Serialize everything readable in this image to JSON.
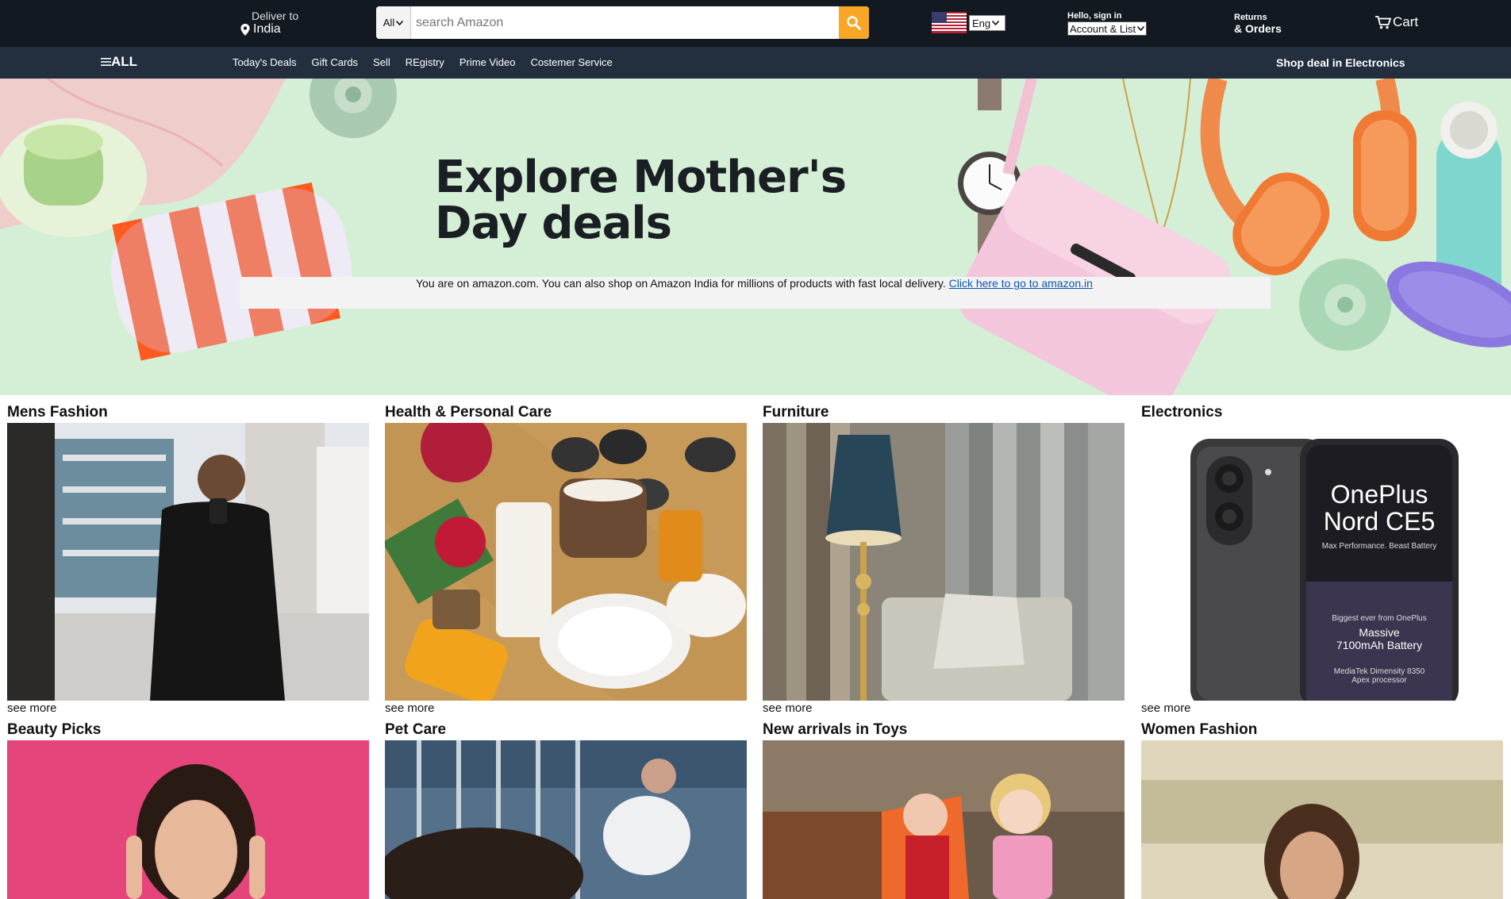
{
  "header": {
    "deliver_to": "Deliver to",
    "location": "India",
    "search_category": "All",
    "search_placeholder": "search Amazon",
    "language": "Eng",
    "greeting": "Hello, sign in",
    "account_select": "Account & List",
    "returns": "Returns",
    "orders": "& Orders",
    "cart": "Cart"
  },
  "nav": {
    "all": "ALL",
    "links": [
      "Today's Deals",
      "Gift Cards",
      "Sell",
      "REgistry",
      "Prime Video",
      "Costemer Service"
    ],
    "promo": "Shop deal in Electronics"
  },
  "hero": {
    "title_line1": "Explore Mother's",
    "title_line2": "Day deals",
    "notice_text": "You are on amazon.com. You can also shop on Amazon India for millions of products with fast local delivery. ",
    "notice_link": "Click here to go to amazon.in"
  },
  "phone_ad": {
    "brand": "OnePlus",
    "model": "Nord CE5",
    "tagline": "Max Performance. Beast Battery",
    "biggest": "Biggest ever from OnePlus",
    "massive": "Massive",
    "battery": "7100mAh Battery",
    "chip": "MediaTek Dimensity 8350",
    "chip2": "Apex processor"
  },
  "cards_row1": [
    {
      "title": "Mens Fashion",
      "more": "see more"
    },
    {
      "title": "Health & Personal Care",
      "more": "see more"
    },
    {
      "title": "Furniture",
      "more": "see more"
    },
    {
      "title": "Electronics",
      "more": "see more"
    }
  ],
  "cards_row2": [
    {
      "title": "Beauty Picks"
    },
    {
      "title": "Pet Care"
    },
    {
      "title": "New arrivals in Toys"
    },
    {
      "title": "Women Fashion"
    }
  ],
  "colors": {
    "header_bg": "#131921",
    "nav_bg": "#232f3e",
    "search_button": "#f7a626",
    "hero_bg": "#d5eed6",
    "link": "#0b57b5"
  }
}
